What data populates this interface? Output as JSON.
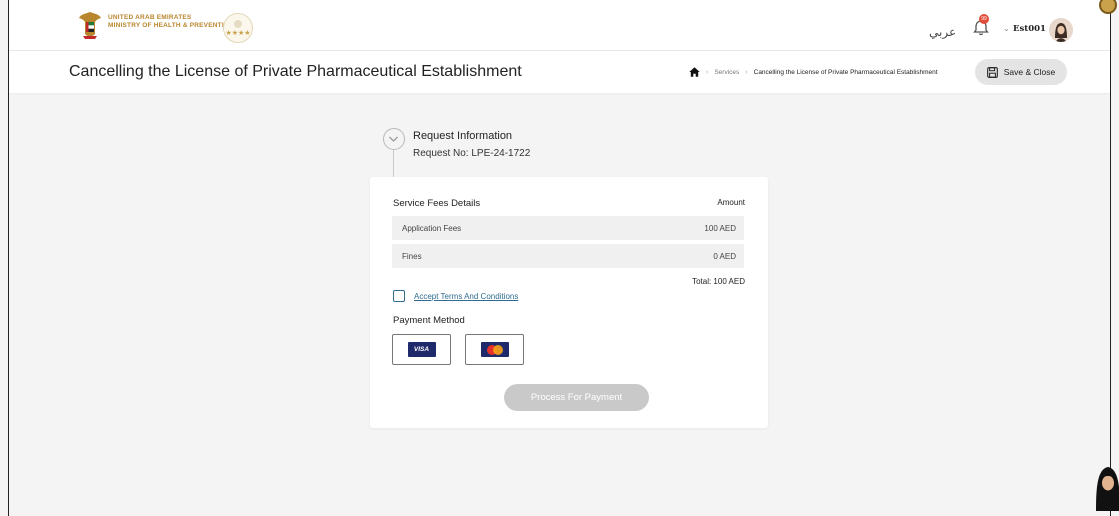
{
  "header": {
    "brand_line1": "UNITED ARAB EMIRATES",
    "brand_line2": "MINISTRY OF HEALTH & PREVENTION",
    "rating_stars": "★★★★",
    "language_toggle": "عربي",
    "notification_count": "99",
    "username": "Est001"
  },
  "titlebar": {
    "title": "Cancelling the License of Private Pharmaceutical Establishment",
    "breadcrumb": {
      "services": "Services",
      "current": "Cancelling the License of Private Pharmaceutical Establishment"
    },
    "save_close_label": "Save & Close"
  },
  "step": {
    "title": "Request Information",
    "request_no": "Request No: LPE-24-1722"
  },
  "fees": {
    "header_label": "Service Fees Details",
    "amount_label": "Amount",
    "rows": [
      {
        "label": "Application Fees",
        "amount": "100 AED"
      },
      {
        "label": "Fines",
        "amount": "0 AED"
      }
    ],
    "total": "Total: 100 AED"
  },
  "terms": {
    "label": "Accept Terms And Conditions",
    "checked": false
  },
  "payment": {
    "method_label": "Payment Method",
    "visa_text": "VISA",
    "options": [
      "visa",
      "mastercard"
    ],
    "process_label": "Process For Payment"
  },
  "colors": {
    "link": "#2f6c8f",
    "brand_gold": "#b8862c",
    "disabled_button": "#c9c9c9",
    "card_brand_navy": "#1f2a6b"
  }
}
